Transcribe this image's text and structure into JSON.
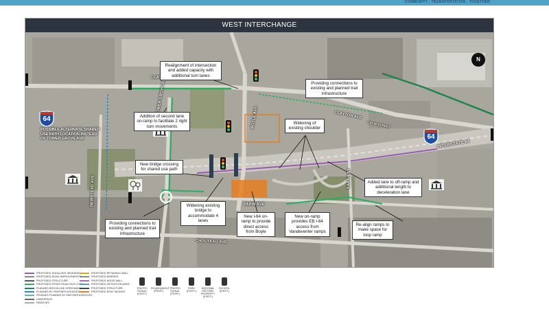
{
  "header": {
    "tagline": "COMMUNITY · TRANSPORTATION · TOGETHER",
    "accent_color": "#4fa3c7"
  },
  "panel": {
    "title": "WEST INTERCHANGE",
    "title_bar_color": "#2c3440"
  },
  "callouts": {
    "realignment": "Realignment of intersection and added capacity with additional turn lanes",
    "trail_north": "Providing connections to existing and planned trail infrastructure",
    "second_lane": "Addition of second lane on-ramp to facilitate 2 right turn movements",
    "widening_shoulder": "Widening of existing shoulder",
    "bridge_shared": "New bridge crossing for shared use path",
    "widening_bridge": "Widening existing bridge to accommodate 4 lanes",
    "trail_south": "Providing connections to existing and planned trail infrastructure",
    "i64_onramp": "New I-64 on-ramp to provide direct access from Boyle",
    "new_onramp": "New on-ramp provides EB I-64 access from Vandeventer ramps",
    "offramp": "Added lane to off-ramp and additional length to deceleration lane",
    "realign_ramps": "Re-align ramps to make space for loop ramp"
  },
  "streets": {
    "clayton_west": "CLAYTON AVE",
    "clayton_east": "CLAYTON AVE",
    "tower_grove": "TOWER GROVE AVE",
    "boyle": "BOYLE AVE",
    "newstead": "NEWSTEAD AVE",
    "papin": "PAPIN AVE",
    "chouteau": "CHOUTEAU AVE",
    "sarah": "SARAH ST",
    "interstate": "INTERSTATE 64",
    "gibson": "CALM STREET"
  },
  "shields": {
    "west_number": "64",
    "east_number": "64"
  },
  "alternate_note": "POSSIBLE ALTERNATE SHARED USE PATH LOCATION INSTEAD OF TOWER GROVE AVE",
  "compass": "N",
  "legend": {
    "items": [
      {
        "label": "PROPOSED SHOULDER WIDENING",
        "color": "#9b59b6"
      },
      {
        "label": "PROPOSED ROAD IMPROVEMENTS",
        "color": "#888888"
      },
      {
        "label": "PROPOSED STRUCTURE",
        "color": "#555555"
      },
      {
        "label": "PROPOSED PEDESTRIAN FACILITIES",
        "color": "#27ae60"
      },
      {
        "label": "PLANNED BROOKLINE GREENWAY",
        "color": "#1e8449"
      },
      {
        "label": "PLANNED BY PARTNER AGENCIES",
        "color": "#2e86c1"
      },
      {
        "label": "PENDING PLANNED BY PARTNER AGENCIES",
        "color": "#5dade2"
      },
      {
        "label": "UNDERPASS",
        "color": "#666666"
      },
      {
        "label": "REMOVED",
        "color": "#aaaaaa"
      },
      {
        "label": "PROPOSED RETAINING WALL",
        "color": "#d4ac0d"
      },
      {
        "label": "PROPOSED BARRIER",
        "color": "#7f8c8d"
      },
      {
        "label": "PROPOSED NOISE WALL",
        "color": "#a569bd"
      },
      {
        "label": "PROPOSED DETENTION AREA",
        "color": "#5499c7"
      },
      {
        "label": "PROPOSED STRUCTURE",
        "color": "#34495e"
      },
      {
        "label": "PROPOSED ROW TAKINGS",
        "color": "#e67e22"
      }
    ],
    "symbols": [
      {
        "label": "TRAFFIC SIGNAL (EXIST.)",
        "icon": "traffic-signal-icon"
      },
      {
        "label": "ROUNDABOUT (PROP.)",
        "icon": "roundabout-icon"
      },
      {
        "label": "TRAFFIC SIGNAL (PROP.)",
        "icon": "traffic-signal-icon"
      },
      {
        "label": "PARK (EXIST.)",
        "icon": "park-icon"
      },
      {
        "label": "NATIONAL HISTORIC PROPERTY (EXIST.)",
        "icon": "historic-building-icon"
      },
      {
        "label": "SCHOOL (EXIST.)",
        "icon": "school-icon"
      }
    ]
  }
}
